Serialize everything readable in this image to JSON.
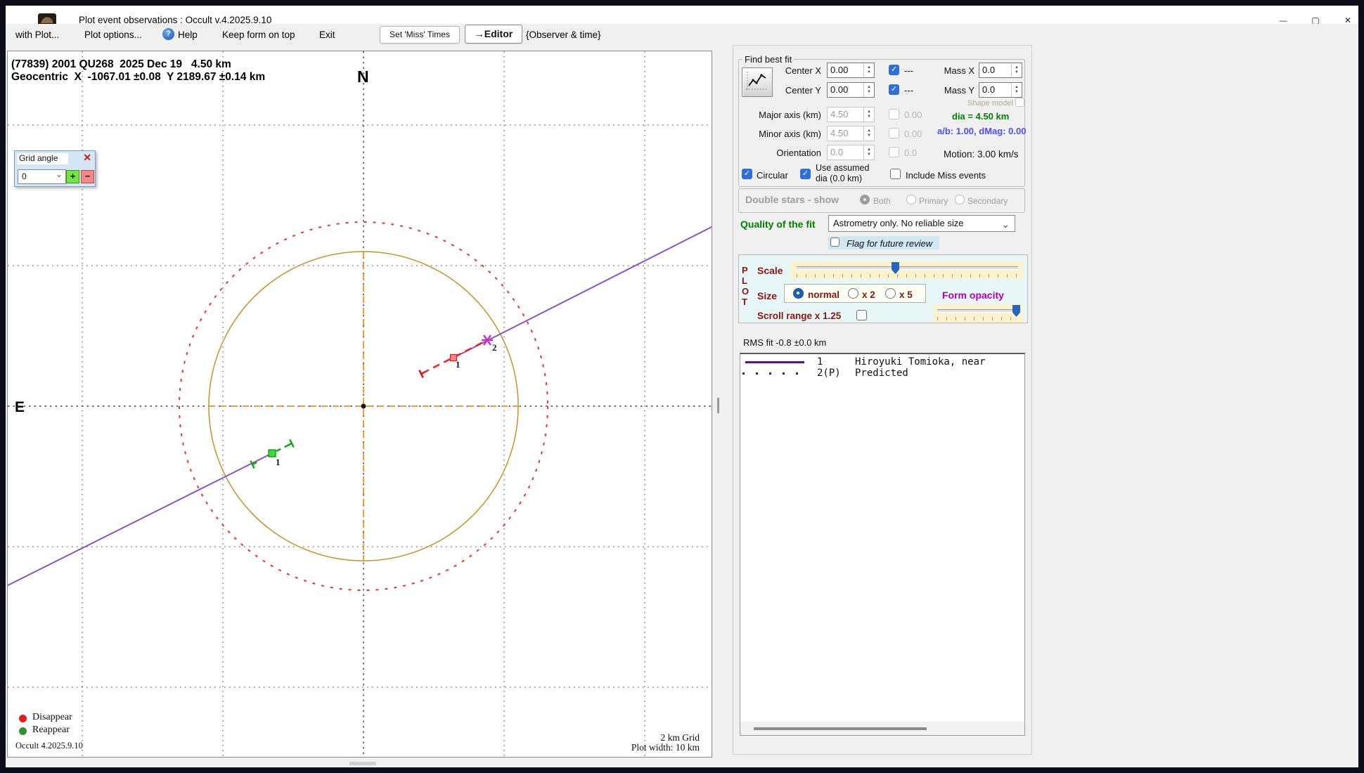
{
  "window": {
    "title": "Plot event observations : Occult v.4.2025.9.10"
  },
  "menu": {
    "items": [
      "with Plot...",
      "Plot options...",
      "Help",
      "Keep form on top",
      "Exit"
    ],
    "set_miss_times": "Set 'Miss' Times",
    "editor": "→Editor",
    "observer_time": "{Observer & time}"
  },
  "plot": {
    "title_line1": "(77839) 2001 QU268  2025 Dec 19   4.50 km",
    "title_line2": "Geocentric  X  -1067.01 ±0.08  Y 2189.67 ±0.14 km",
    "north": "N",
    "east": "E",
    "chord1_green_label": "1",
    "chord1_red_label": "1",
    "star_label": "2",
    "legend": {
      "disappear": "Disappear",
      "reappear": "Reappear"
    },
    "version": "Occult 4.2025.9.10",
    "grid_note": "2 km Grid",
    "width_note": "Plot width: 10 km",
    "colors": {
      "asteroid_circle": "#c8922a",
      "uncertainty_circle": "#f03030",
      "track_line": "#8a52cc",
      "disappear_dot": "#e81a1e",
      "reappear_dot": "#2e9230"
    }
  },
  "grid_angle": {
    "title": "Grid angle",
    "value": "0",
    "plus": "+",
    "minus": "−"
  },
  "find_best_fit": {
    "title": "Find best fit",
    "center_x_label": "Center X",
    "center_x_value": "0.00",
    "center_x_extra": "---",
    "center_y_label": "Center Y",
    "center_y_value": "0.00",
    "center_y_extra": "---",
    "mass_x_label": "Mass X",
    "mass_x_value": "0.0",
    "mass_y_label": "Mass Y",
    "mass_y_value": "0.0",
    "shape_model_label": "Shape model",
    "major_axis_label": "Major axis (km)",
    "major_axis_value": "4.50",
    "major_axis_err": "0.00",
    "minor_axis_label": "Minor axis (km)",
    "minor_axis_value": "4.50",
    "minor_axis_err": "0.00",
    "orientation_label": "Orientation",
    "orientation_value": "0.0",
    "orientation_err": "0.0",
    "dia_text": "dia = 4.50 km",
    "ab_text": "a/b: 1.00, dMag: 0.00",
    "motion_text": "Motion: 3.00 km/s",
    "circular_label": "Circular",
    "use_assumed_line1": "Use assumed",
    "use_assumed_line2": "dia (0.0 km)",
    "include_miss_label": "Include Miss events"
  },
  "double_stars": {
    "title": "Double stars - show",
    "options": [
      "Both",
      "Primary",
      "Secondary"
    ]
  },
  "quality": {
    "label": "Quality of the fit",
    "value": "Astrometry only. No reliable size",
    "flag_label": "Flag for future review"
  },
  "plot_panel": {
    "letters": [
      "P",
      "L",
      "O",
      "T"
    ],
    "scale_label": "Scale",
    "size_label": "Size",
    "size_options": [
      "normal",
      "x 2",
      "x 5"
    ],
    "form_opacity_label": "Form opacity",
    "scroll_range_label": "Scroll range x 1.25"
  },
  "rms_text": "RMS fit -0.8 ±0.0 km",
  "fit_list": {
    "rows": [
      {
        "num": "1",
        "name": "Hiroyuki Tomioka, near"
      },
      {
        "num": "2(P)",
        "name": "Predicted"
      }
    ]
  }
}
